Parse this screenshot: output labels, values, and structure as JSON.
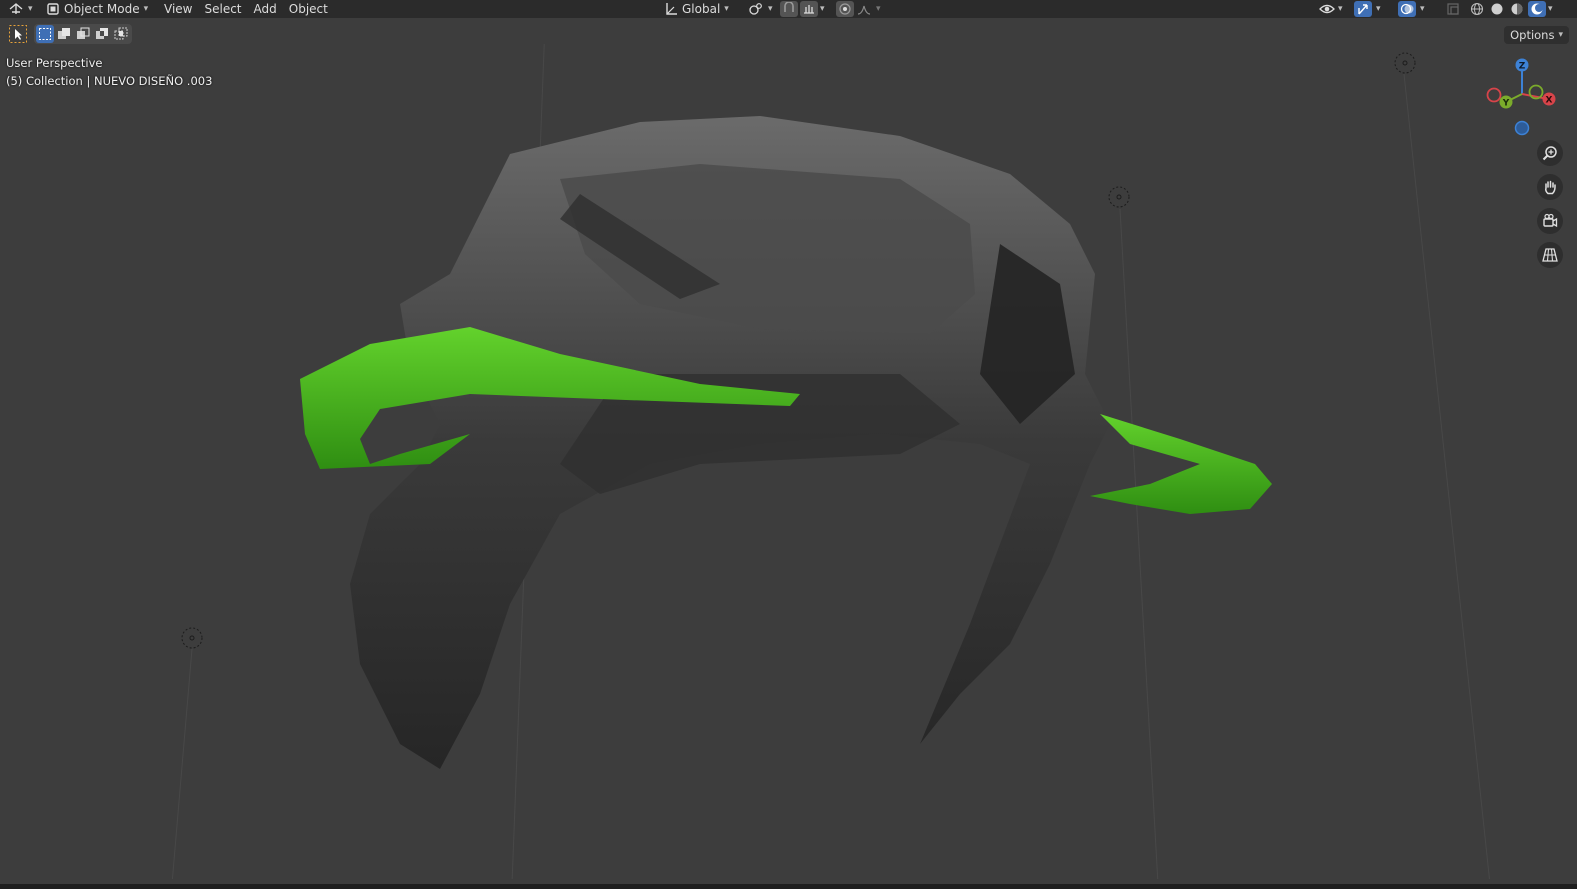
{
  "header": {
    "mode_label": "Object Mode",
    "menus": [
      "View",
      "Select",
      "Add",
      "Object"
    ],
    "transform_orientation": "Global"
  },
  "viewport": {
    "view_name": "User Perspective",
    "collection_info": "(5) Collection | NUEVO DISEÑO .003",
    "options_label": "Options"
  },
  "gizmo": {
    "z_label": "Z",
    "y_label": "Y",
    "x_label": "X"
  },
  "icons": {
    "editor_type": "editor-type-icon",
    "mode": "object-mode-icon",
    "orientation": "transform-orientation-icon",
    "pivot": "pivot-point-icon",
    "snap": "snap-icon",
    "proportional": "proportional-edit-icon",
    "visibility": "object-visibility-icon",
    "gizmos": "gizmo-icon",
    "overlays": "overlay-icon",
    "xray": "xray-icon",
    "shading": [
      "wireframe-shading-icon",
      "solid-shading-icon",
      "material-shading-icon",
      "rendered-shading-icon"
    ],
    "nav": [
      "zoom-icon",
      "pan-hand-icon",
      "camera-view-icon",
      "ortho-grid-icon"
    ]
  },
  "colors": {
    "background": "#3d3d3d",
    "header": "#2b2b2b",
    "active_blue": "#3f6fb5",
    "mesh_green": "#4fbf1f",
    "axis_x": "#d8444a",
    "axis_y": "#7bab2b",
    "axis_z": "#3d82d6"
  }
}
